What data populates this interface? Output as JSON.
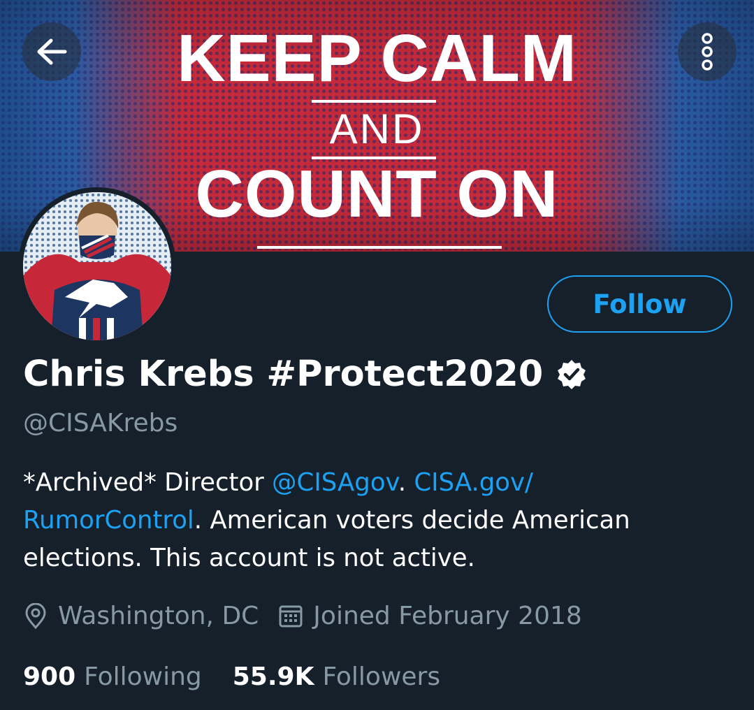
{
  "banner": {
    "line1": "KEEP CALM",
    "line2": "AND",
    "line3": "COUNT ON"
  },
  "nav": {
    "back_icon": "arrow-left-icon",
    "more_icon": "more-vertical-icon"
  },
  "profile": {
    "display_name": "Chris Krebs #Protect2020",
    "handle": "@CISAKrebs",
    "verified_icon": "verified-badge-icon",
    "follow_label": "Follow",
    "bio": {
      "part1": "*Archived* Director ",
      "mention": "@CISAgov",
      "part2": ". ",
      "link": "CISA.gov/\nRumorControl",
      "part3": ". American voters decide American elections. This account is not active."
    },
    "location": "Washington, DC",
    "location_icon": "location-pin-icon",
    "joined": "Joined February 2018",
    "joined_icon": "calendar-icon",
    "following_count": "900",
    "following_label": "Following",
    "followers_count": "55.9K",
    "followers_label": "Followers"
  },
  "colors": {
    "background": "#15202b",
    "accent": "#1da1f2",
    "secondary_text": "#8899a6"
  }
}
